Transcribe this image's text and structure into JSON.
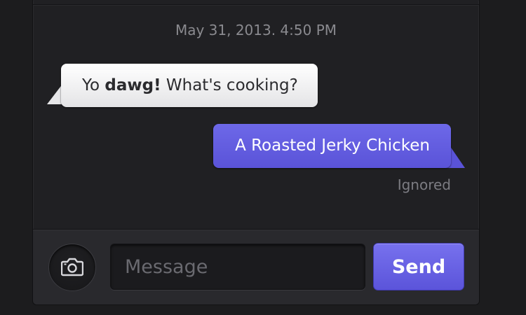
{
  "thread": {
    "timestamp": "May 31, 2013. 4:50 PM",
    "incoming": {
      "prefix": "Yo ",
      "bold": "dawg!",
      "suffix": " What's cooking?"
    },
    "outgoing": {
      "text": "A Roasted Jerky Chicken",
      "status": "Ignored"
    }
  },
  "composer": {
    "camera_icon": "camera-icon",
    "placeholder": "Message",
    "value": "",
    "send_label": "Send"
  },
  "colors": {
    "accent": "#5b54da",
    "incoming_bubble": "#f2f2f4",
    "background": "#202023"
  }
}
